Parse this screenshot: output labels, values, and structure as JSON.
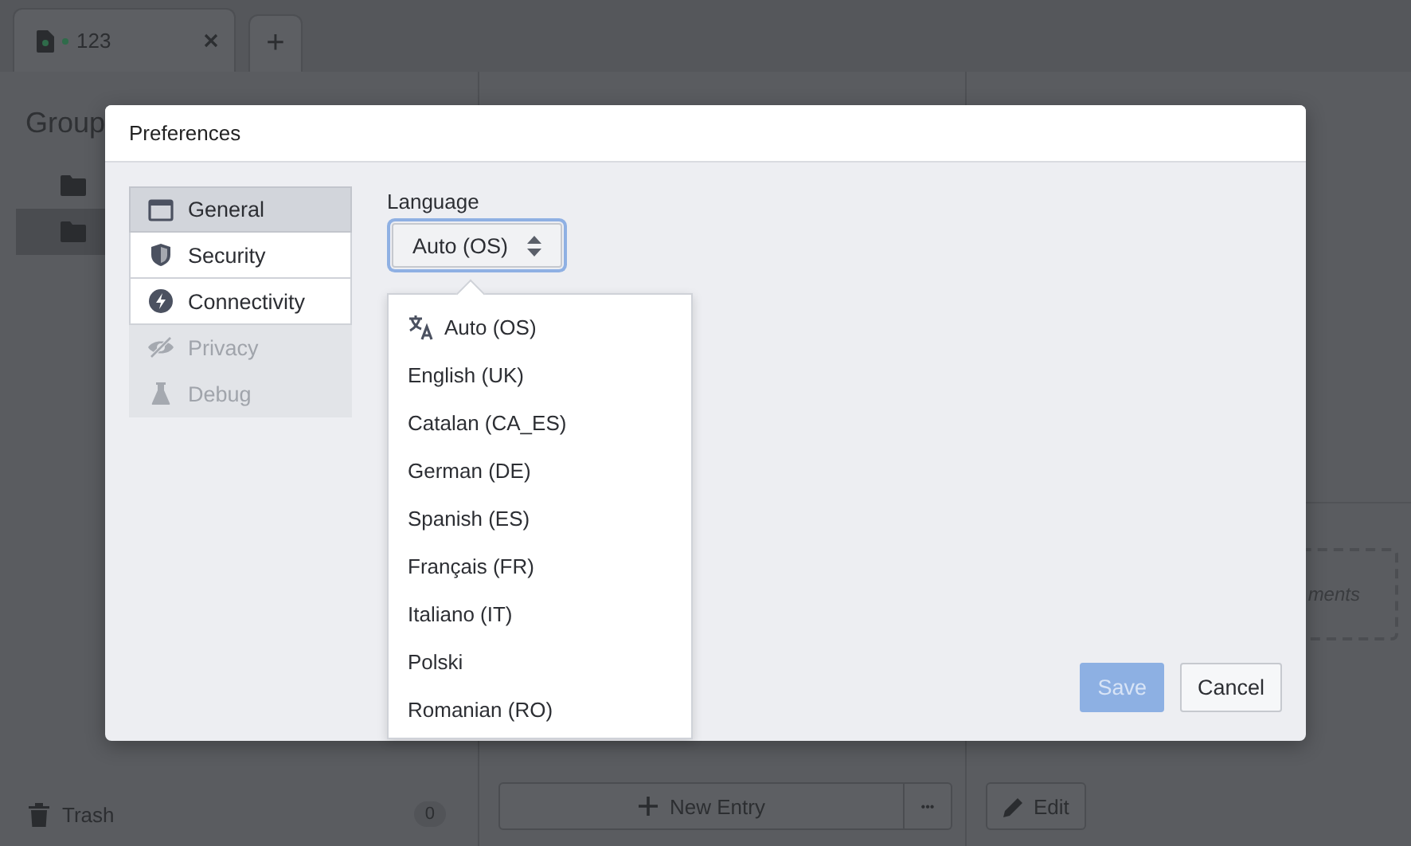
{
  "tabs": [
    {
      "label": "123",
      "modified": true
    }
  ],
  "new_tab": {
    "label": "+"
  },
  "sidebar": {
    "title": "Group",
    "items": [
      {
        "selected": false
      },
      {
        "selected": true
      }
    ],
    "trash": {
      "label": "Trash",
      "count": "0"
    }
  },
  "entries": {
    "new_entry": "New Entry",
    "more": "•••"
  },
  "details": {
    "attachments_hint": "ments",
    "edit": "Edit"
  },
  "dialog": {
    "title": "Preferences",
    "nav": [
      {
        "label": "General",
        "kind": "general",
        "selected": true,
        "disabled": false
      },
      {
        "label": "Security",
        "kind": "security",
        "selected": false,
        "disabled": false
      },
      {
        "label": "Connectivity",
        "kind": "connectivity",
        "selected": false,
        "disabled": false
      },
      {
        "label": "Privacy",
        "kind": "privacy",
        "selected": false,
        "disabled": true
      },
      {
        "label": "Debug",
        "kind": "debug",
        "selected": false,
        "disabled": true
      }
    ],
    "language": {
      "label": "Language",
      "value": "Auto (OS)",
      "expanded": true,
      "options": [
        {
          "label": "Auto (OS)",
          "kind": "auto"
        },
        {
          "label": "English (UK)",
          "kind": "language"
        },
        {
          "label": "Catalan (CA_ES)",
          "kind": "language"
        },
        {
          "label": "German (DE)",
          "kind": "language"
        },
        {
          "label": "Spanish (ES)",
          "kind": "language"
        },
        {
          "label": "Français (FR)",
          "kind": "language"
        },
        {
          "label": "Italiano (IT)",
          "kind": "language"
        },
        {
          "label": "Polski",
          "kind": "language"
        },
        {
          "label": "Romanian (RO)",
          "kind": "language"
        }
      ]
    },
    "buttons": [
      {
        "label": "Save",
        "disabled": true
      },
      {
        "label": "Cancel",
        "disabled": false
      }
    ]
  }
}
